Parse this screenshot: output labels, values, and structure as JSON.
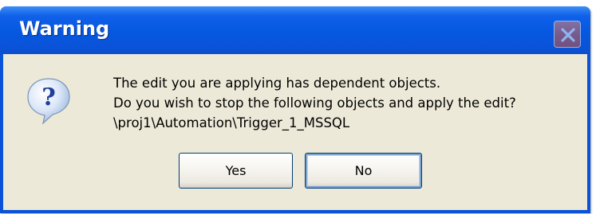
{
  "dialog": {
    "title": "Warning",
    "icon": "question-icon",
    "message_lines": [
      "The edit you are applying has dependent objects.",
      "Do you wish to stop the following objects and apply the edit?",
      "\\proj1\\Automation\\Trigger_1_MSSQL"
    ],
    "buttons": {
      "yes_label": "Yes",
      "no_label": "No"
    }
  },
  "colors": {
    "titlebar": "#0a53d8",
    "dialog_background": "#ece9d8",
    "close_button": "#d25a40"
  }
}
